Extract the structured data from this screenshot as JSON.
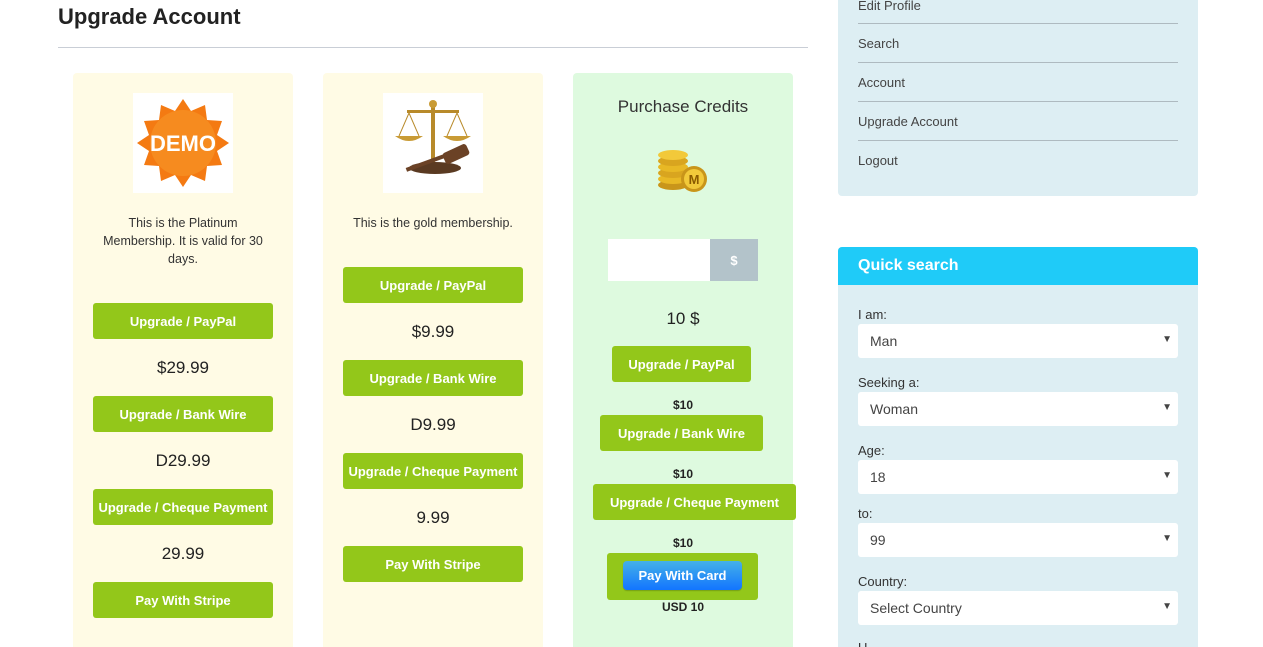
{
  "page": {
    "title": "Upgrade Account"
  },
  "cards": [
    {
      "image": "demo-badge",
      "description": "This is the Platinum Membership. It is valid for 30 days.",
      "buttons": [
        "Upgrade / PayPal",
        "Upgrade / Bank Wire",
        "Upgrade / Cheque Payment",
        "Pay With Stripe"
      ],
      "prices": [
        "$29.99",
        "D29.99",
        "29.99"
      ]
    },
    {
      "image": "justice-scale",
      "description": "This is the gold membership.",
      "buttons": [
        "Upgrade / PayPal",
        "Upgrade / Bank Wire",
        "Upgrade / Cheque Payment",
        "Pay With Stripe"
      ],
      "prices": [
        "$9.99",
        "D9.99",
        "9.99"
      ]
    }
  ],
  "credits": {
    "title": "Purchase Credits",
    "image": "coins-icon",
    "input_value": "",
    "currency": "$",
    "total": "10 $",
    "buttons": [
      "Upgrade / PayPal",
      "Upgrade / Bank Wire",
      "Upgrade / Cheque Payment"
    ],
    "small_prices": [
      "$10",
      "$10",
      "$10"
    ],
    "stripe_label": "Pay With Card",
    "stripe_amount": "USD 10"
  },
  "sidebar": {
    "nav": [
      "Edit Profile",
      "Search",
      "Account",
      "Upgrade Account",
      "Logout"
    ]
  },
  "quick_search": {
    "title": "Quick search",
    "fields": [
      {
        "label": "I am:",
        "value": "Man"
      },
      {
        "label": "Seeking a:",
        "value": "Woman"
      },
      {
        "label": "Age:",
        "value": "18"
      },
      {
        "label": "to:",
        "value": "99"
      },
      {
        "label": "Country:",
        "value": "Select Country"
      }
    ],
    "next_label": "U"
  },
  "colors": {
    "button_green": "#93c71a",
    "card_yellow": "#fffbe5",
    "card_green": "#defadf",
    "sidebar_bg": "#ddeef3",
    "header_blue": "#1fcbf8"
  }
}
